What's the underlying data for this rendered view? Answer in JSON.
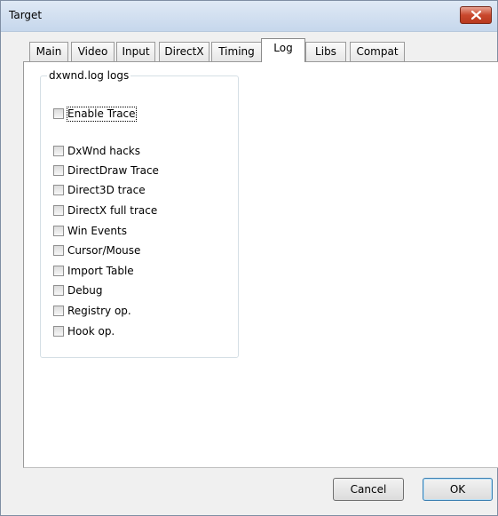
{
  "window": {
    "title": "Target"
  },
  "tabs": [
    {
      "label": "Main"
    },
    {
      "label": "Video"
    },
    {
      "label": "Input"
    },
    {
      "label": "DirectX"
    },
    {
      "label": "Timing"
    },
    {
      "label": "Log",
      "active": true
    },
    {
      "label": "Libs"
    },
    {
      "label": "Compat"
    }
  ],
  "log_group": {
    "title": "dxwnd.log logs",
    "enable_trace": {
      "label": "Enable Trace",
      "checked": false
    },
    "options": [
      {
        "label": "DxWnd hacks",
        "checked": false
      },
      {
        "label": "DirectDraw Trace",
        "checked": false
      },
      {
        "label": "Direct3D trace",
        "checked": false
      },
      {
        "label": "DirectX full trace",
        "checked": false
      },
      {
        "label": "Win Events",
        "checked": false
      },
      {
        "label": "Cursor/Mouse",
        "checked": false
      },
      {
        "label": "Import Table",
        "checked": false
      },
      {
        "label": "Debug",
        "checked": false
      },
      {
        "label": "Registry op.",
        "checked": false
      },
      {
        "label": "Hook op.",
        "checked": false
      }
    ]
  },
  "buttons": {
    "cancel": "Cancel",
    "ok": "OK"
  },
  "colors": {
    "titlebar": "#c6d7ec",
    "close": "#c9482d",
    "dialog_bg": "#f0f0f0",
    "panel_bg": "#ffffff"
  }
}
